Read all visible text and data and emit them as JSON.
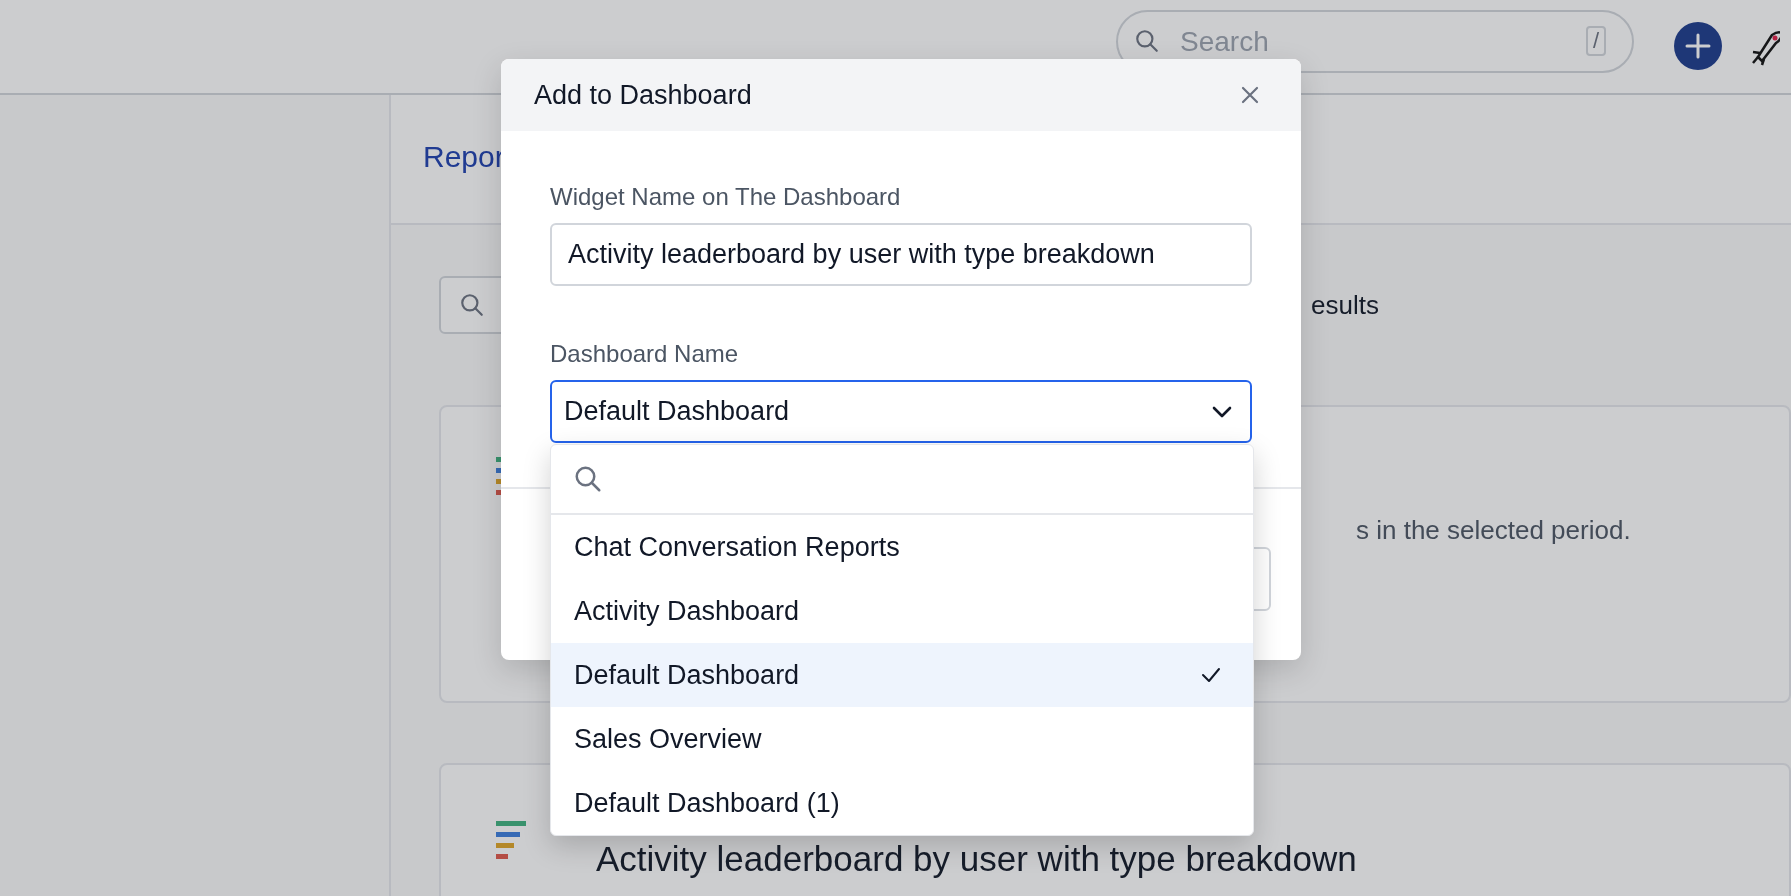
{
  "top_bar": {
    "search": {
      "placeholder": "Search",
      "shortcut": "/"
    }
  },
  "background": {
    "header": "Repor",
    "results": "esults",
    "cards": [
      {
        "kind": "partial",
        "description": "s in the selected period."
      },
      {
        "kind": "full",
        "title": "Activity leaderboard by user with type breakdown"
      }
    ]
  },
  "dialog": {
    "title": "Add to Dashboard",
    "widget_name": {
      "label": "Widget Name on The Dashboard",
      "value": "Activity leaderboard by user with type breakdown"
    },
    "dashboard_name": {
      "label": "Dashboard Name",
      "value": "Default Dashboard",
      "expanded": true,
      "options": [
        {
          "label": "Chat Conversation Reports",
          "selected": false
        },
        {
          "label": "Activity Dashboard",
          "selected": false
        },
        {
          "label": "Default Dashboard",
          "selected": true
        },
        {
          "label": "Sales Overview",
          "selected": false
        },
        {
          "label": "Default Dashboard (1)",
          "selected": false
        }
      ]
    }
  }
}
